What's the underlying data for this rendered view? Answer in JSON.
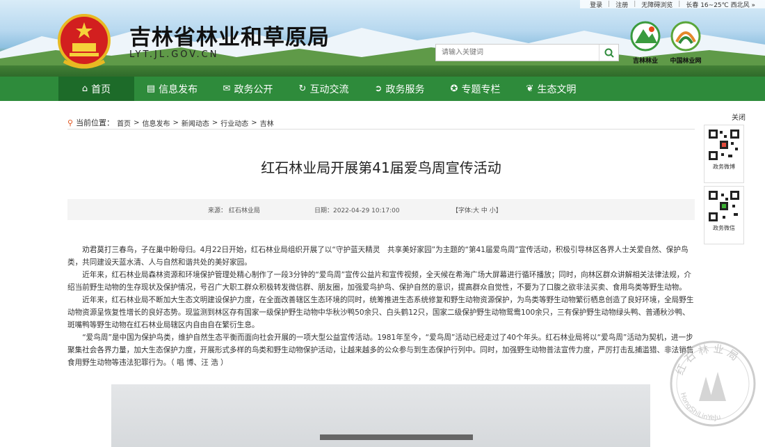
{
  "top_links": {
    "login": "登录",
    "register": "注册",
    "accessible": "无障碍浏览",
    "weather": "长春 16~25℃ 西北风 »"
  },
  "header": {
    "title": "吉林省林业和草原局",
    "domain": "LYT.JL.GOV.CN",
    "search_placeholder": "请输入关键词",
    "logo1_label": "吉林林业",
    "logo2_label": "中国林业网"
  },
  "nav": {
    "items": [
      {
        "label": "首页",
        "icon": "home-icon"
      },
      {
        "label": "信息发布",
        "icon": "document-icon"
      },
      {
        "label": "政务公开",
        "icon": "chat-icon"
      },
      {
        "label": "互动交流",
        "icon": "refresh-icon"
      },
      {
        "label": "政务服务",
        "icon": "arrow-circle-icon"
      },
      {
        "label": "专题专栏",
        "icon": "compass-icon"
      },
      {
        "label": "生态文明",
        "icon": "leaf-icon"
      }
    ]
  },
  "breadcrumb": {
    "prefix": "当前位置：",
    "items": [
      "首页",
      "信息发布",
      "新闻动态",
      "行业动态",
      "吉林"
    ]
  },
  "article": {
    "title": "红石林业局开展第41届爱鸟周宣传活动",
    "source": "来源： 红石林业局",
    "date": "日期：2022-04-29 10:17:00",
    "font_size": "【字体:大 中 小】",
    "paragraphs": [
      "劝君莫打三春鸟，子在巢中盼母归。4月22日开始，红石林业局组织开展了以“守护蓝天精灵　共享美好家园”为主题的“第41届爱鸟周”宣传活动，积极引导林区各界人士关爱自然、保护鸟类，共同建设天蓝水清、人与自然和谐共处的美好家园。",
      "近年来，红石林业局森林资源和环境保护管理处精心制作了一段3分钟的“爱鸟周”宣传公益片和宣传视频，全天候在希海广场大屏幕进行循环播放；同时，向林区群众讲解相关法律法规，介绍当前野生动物的生存现状及保护情况，号召广大职工群众积极转发微信群、朋友圈，加强爱鸟护鸟、保护自然的意识，提高群众自觉性，不要为了口腹之欲非法买卖、食用鸟类等野生动物。",
      "近年来，红石林业局不断加大生态文明建设保护力度，在全面改善辖区生态环境的同时，统筹推进生态系统修复和野生动物资源保护，为鸟类等野生动物繁衍栖息创造了良好环境，全局野生动物资源呈恢复性增长的良好态势。现监测到林区存有国家一级保护野生动物中华秋沙鸭50余只、白头鹤12只，国家二级保护野生动物鸳鸯100余只，三有保护野生动物绿头鸭、普通秋沙鸭、斑嘴鸭等野生动物在红石林业局辖区内自由自在繁衍生息。",
      "“爱鸟周”是中国为保护鸟类，维护自然生态平衡而面向社会开展的一项大型公益宣传活动。1981年至今，“爱鸟周”活动已经走过了40个年头。红石林业局将以“爱鸟周”活动为契机，进一步聚集社会各界力量，加大生态保护力度，开展形式多样的鸟类和野生动物保护活动，让越来越多的公众参与到生态保护行列中。同时，加强野生动物普法宣传力度，严厉打击乱捕滥猎、非法销售食用野生动物等违法犯罪行为。（ 唱 博、汪 浩 ）"
    ]
  },
  "side": {
    "close": "关闭",
    "qr1_label": "政务微博",
    "qr2_label": "政务微信"
  },
  "stamp": {
    "top_text": "红石林业局",
    "bottom_text": "HongShiLinYeJu"
  }
}
